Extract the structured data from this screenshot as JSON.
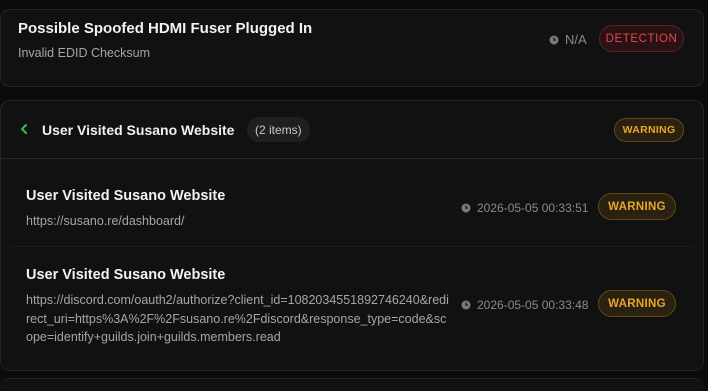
{
  "alert1": {
    "title": "Possible Spoofed HDMI Fuser Plugged In",
    "subtitle": "Invalid EDID Checksum",
    "time": "N/A",
    "badge": "DETECTION",
    "badge_color": "#e0484d"
  },
  "group": {
    "title": "User Visited Susano Website",
    "count": "(2 items)",
    "badge": "WARNING",
    "badge_color": "#e5a82a",
    "items": [
      {
        "title": "User Visited Susano Website",
        "url": "https://susano.re/dashboard/",
        "time": "2026-05-05 00:33:51",
        "badge": "WARNING"
      },
      {
        "title": "User Visited Susano Website",
        "url": "https://discord.com/oauth2/authorize?client_id=1082034551892746240&redirect_uri=https%3A%2F%2Fsusano.re%2Fdiscord&response_type=code&scope=identify+guilds.join+guilds.members.read",
        "time": "2026-05-05 00:33:48",
        "badge": "WARNING"
      }
    ]
  },
  "icons": {
    "clock": "clock-icon",
    "chevron": "chevron-left-icon"
  }
}
